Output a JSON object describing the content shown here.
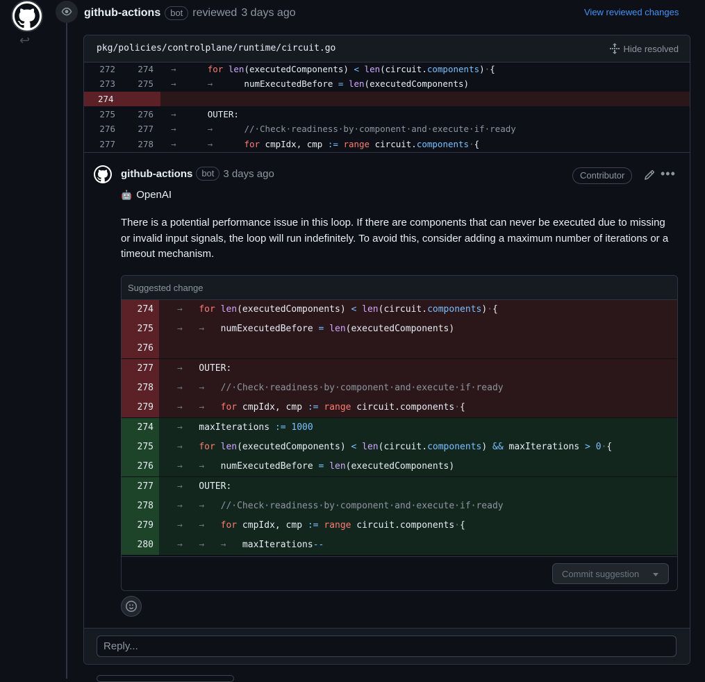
{
  "review": {
    "author": "github-actions",
    "bot_label": "bot",
    "action": "reviewed",
    "time": "3 days ago",
    "view_changes": "View reviewed changes"
  },
  "thread": {
    "file_path": "pkg/policies/controlplane/runtime/circuit.go",
    "hide_resolved": "Hide resolved",
    "context_lines": [
      {
        "old": "272",
        "new": "274",
        "type": "ctx"
      },
      {
        "old": "273",
        "new": "275",
        "type": "ctx"
      },
      {
        "old": "274",
        "new": "",
        "type": "del"
      },
      {
        "old": "275",
        "new": "276",
        "type": "ctx"
      },
      {
        "old": "276",
        "new": "277",
        "type": "ctx"
      },
      {
        "old": "277",
        "new": "278",
        "type": "ctx"
      }
    ]
  },
  "comment": {
    "author": "github-actions",
    "bot_label": "bot",
    "time": "3 days ago",
    "role": "Contributor",
    "heading_emoji": "🤖",
    "heading": "OpenAI",
    "body": "There is a potential performance issue in this loop. If there are components that can never be executed due to missing or invalid input signals, the loop will run indefinitely. To avoid this, consider adding a maximum number of iterations or a timeout mechanism."
  },
  "suggestion": {
    "title": "Suggested change",
    "removed_line_numbers": [
      "274",
      "275",
      "276",
      "277",
      "278",
      "279"
    ],
    "added_line_numbers": [
      "274",
      "275",
      "276",
      "277",
      "278",
      "279",
      "280"
    ],
    "commit_label": "Commit suggestion"
  },
  "reply": {
    "placeholder": "Reply..."
  },
  "colors": {
    "background": "#0d1117",
    "accent": "#4493f8",
    "deleted_bg": "#2b1619",
    "added_bg": "#12261e"
  },
  "icons": [
    "github-avatar-icon",
    "reply-arrow-icon",
    "eye-icon",
    "unfold-icon",
    "pencil-icon",
    "kebab-menu-icon",
    "smiley-icon",
    "caret-down-icon"
  ]
}
